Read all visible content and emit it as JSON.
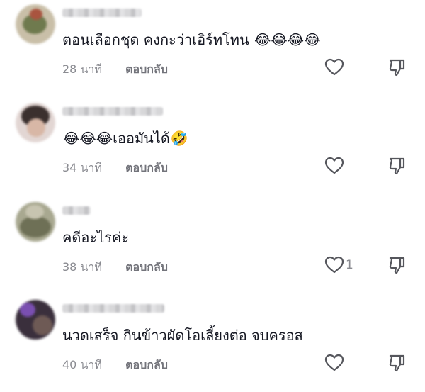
{
  "comments": [
    {
      "text": "ตอนเลือกชุด คงกะว่าเอิร์ทโทน",
      "emojis": "😂😂😂😂",
      "emoji_position": "after",
      "time": "28 นาที",
      "reply_label": "ตอบกลับ",
      "like_count": ""
    },
    {
      "text": "เออมันได้",
      "emojis": "😂😂😂",
      "emoji_position": "before",
      "trailing_emoji": "🤣",
      "time": "34 นาที",
      "reply_label": "ตอบกลับ",
      "like_count": ""
    },
    {
      "text": "คดีอะไรค่ะ",
      "emojis": "",
      "time": "38 นาที",
      "reply_label": "ตอบกลับ",
      "like_count": "1"
    },
    {
      "text": "นวดเสร็จ กินข้าวผัดโอเลี้ยงต่อ จบครอส",
      "emojis": "",
      "time": "40 นาที",
      "reply_label": "ตอบกลับ",
      "like_count": ""
    }
  ],
  "icons": {
    "like": "heart-outline-icon",
    "dislike": "thumbs-down-icon"
  },
  "colors": {
    "text": "#161823",
    "meta": "#8a8b91"
  }
}
